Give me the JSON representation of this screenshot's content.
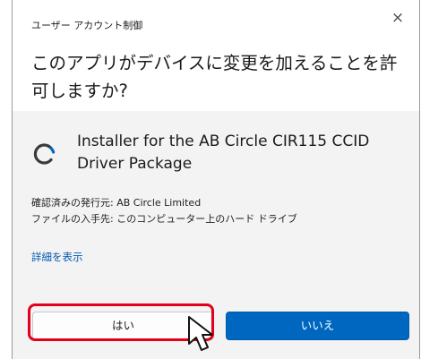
{
  "dialog": {
    "caption": "ユーザー アカウント制御",
    "close_glyph": "×",
    "question": "このアプリがデバイスに変更を加えることを許可しますか?",
    "app_name": "Installer for the AB Circle CIR115 CCID Driver Package",
    "publisher": "確認済みの発行元: AB Circle Limited",
    "origin": "ファイルの入手先: このコンピューター上のハード ドライブ",
    "details_link": "詳細を表示",
    "yes_label": "はい",
    "no_label": "いいえ"
  },
  "colors": {
    "header_bg": "#ffffff",
    "body_bg": "#f3f3f3",
    "accent_button": "#0067c0",
    "link": "#0058b0",
    "highlight": "#e2001a"
  },
  "icons": {
    "close": "close-icon",
    "app": "installer-spinner-icon",
    "cursor": "mouse-pointer-icon"
  }
}
